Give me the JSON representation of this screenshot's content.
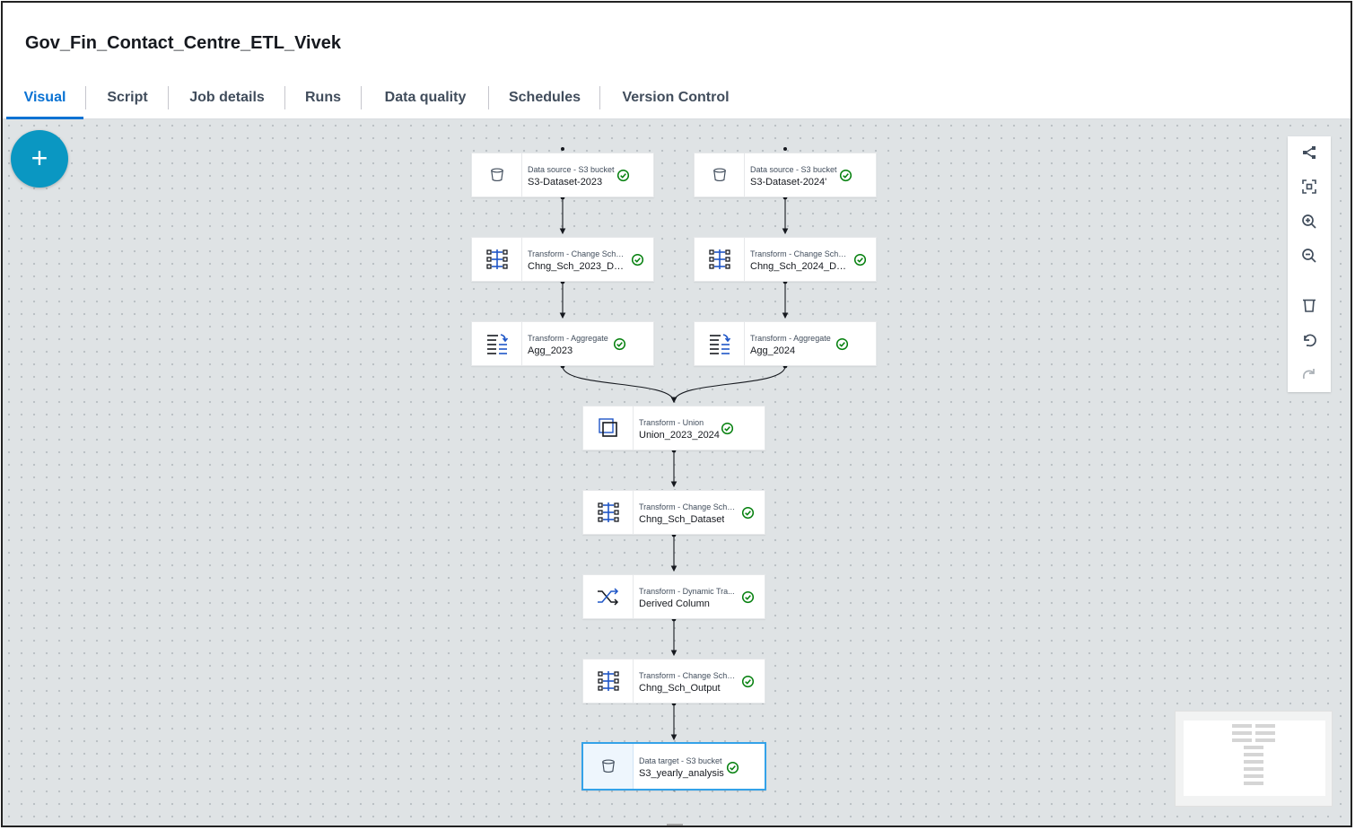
{
  "header": {
    "job_title": "Gov_Fin_Contact_Centre_ETL_Vivek"
  },
  "tabs": [
    {
      "label": "Visual",
      "active": true
    },
    {
      "label": "Script",
      "active": false
    },
    {
      "label": "Job details",
      "active": false
    },
    {
      "label": "Runs",
      "active": false
    },
    {
      "label": "Data quality",
      "active": false
    },
    {
      "label": "Schedules",
      "active": false
    },
    {
      "label": "Version Control",
      "active": false
    }
  ],
  "canvas": {
    "add_button_label": "+"
  },
  "nodes": {
    "src_2023": {
      "type": "Data source - S3 bucket",
      "name": "S3-Dataset-2023",
      "icon": "bucket-icon",
      "status": "valid"
    },
    "src_2024": {
      "type": "Data source - S3 bucket",
      "name": "S3-Dataset-2024'",
      "icon": "bucket-icon",
      "status": "valid"
    },
    "chng_2023": {
      "type": "Transform - Change Sche...",
      "name": "Chng_Sch_2023_Dat...",
      "icon": "schema-icon",
      "status": "valid"
    },
    "chng_2024": {
      "type": "Transform - Change Sche...",
      "name": "Chng_Sch_2024_Dat...",
      "icon": "schema-icon",
      "status": "valid"
    },
    "agg_2023": {
      "type": "Transform - Aggregate",
      "name": "Agg_2023",
      "icon": "aggregate-icon",
      "status": "valid"
    },
    "agg_2024": {
      "type": "Transform - Aggregate",
      "name": "Agg_2024",
      "icon": "aggregate-icon",
      "status": "valid"
    },
    "union": {
      "type": "Transform - Union",
      "name": "Union_2023_2024",
      "icon": "union-icon",
      "status": "valid"
    },
    "chng_dataset": {
      "type": "Transform - Change Sche...",
      "name": "Chng_Sch_Dataset",
      "icon": "schema-icon",
      "status": "valid"
    },
    "derived": {
      "type": "Transform - Dynamic Tra...",
      "name": "Derived Column",
      "icon": "shuffle-icon",
      "status": "valid"
    },
    "chng_output": {
      "type": "Transform - Change Sche...",
      "name": "Chng_Sch_Output",
      "icon": "schema-icon",
      "status": "valid"
    },
    "target": {
      "type": "Data target - S3 bucket",
      "name": "S3_yearly_analysis",
      "icon": "bucket-icon",
      "status": "valid",
      "selected": true
    }
  },
  "toolbar": {
    "buttons": [
      "layout-icon",
      "fit-view-icon",
      "zoom-in-icon",
      "zoom-out-icon",
      "delete-icon",
      "undo-icon",
      "redo-icon"
    ]
  },
  "colors": {
    "accent": "#0972d3",
    "add_button": "#0a97c2",
    "valid_check": "#037f0c",
    "canvas": "#dfe3e5",
    "icon_blue": "#1f56c7"
  }
}
